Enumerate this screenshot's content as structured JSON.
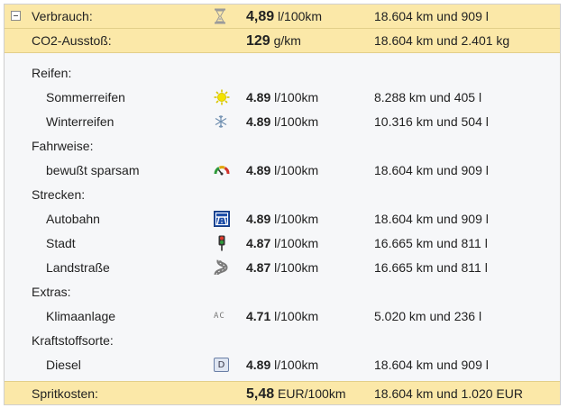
{
  "summary": {
    "consumption": {
      "label": "Verbrauch:",
      "value": "4,89",
      "unit": "l/100km",
      "distance": "18.604 km und 909 l"
    },
    "co2": {
      "label": "CO2-Ausstoß:",
      "value": "129",
      "unit": "g/km",
      "distance": "18.604 km und 2.401 kg"
    },
    "fuel_cost": {
      "label": "Spritkosten:",
      "value": "5,48",
      "unit": "EUR/100km",
      "distance": "18.604 km und 1.020 EUR"
    }
  },
  "categories": [
    {
      "label": "Reifen:",
      "items": [
        {
          "label": "Sommerreifen",
          "icon": "sun-icon",
          "value": "4.89",
          "unit": "l/100km",
          "distance": "8.288 km und 405 l"
        },
        {
          "label": "Winterreifen",
          "icon": "snowflake-icon",
          "value": "4.89",
          "unit": "l/100km",
          "distance": "10.316 km und 504 l"
        }
      ]
    },
    {
      "label": "Fahrweise:",
      "items": [
        {
          "label": "bewußt sparsam",
          "icon": "eco-gauge-icon",
          "value": "4.89",
          "unit": "l/100km",
          "distance": "18.604 km und 909 l"
        }
      ]
    },
    {
      "label": "Strecken:",
      "items": [
        {
          "label": "Autobahn",
          "icon": "highway-icon",
          "value": "4.89",
          "unit": "l/100km",
          "distance": "18.604 km und 909 l"
        },
        {
          "label": "Stadt",
          "icon": "traffic-light-icon",
          "value": "4.87",
          "unit": "l/100km",
          "distance": "16.665 km und 811 l"
        },
        {
          "label": "Landstraße",
          "icon": "winding-road-icon",
          "value": "4.87",
          "unit": "l/100km",
          "distance": "16.665 km und 811 l"
        }
      ]
    },
    {
      "label": "Extras:",
      "items": [
        {
          "label": "Klimaanlage",
          "icon": "ac-icon",
          "icon_text": "AC",
          "value": "4.71",
          "unit": "l/100km",
          "distance": "5.020 km und 236 l"
        }
      ]
    },
    {
      "label": "Kraftstoffsorte:",
      "items": [
        {
          "label": "Diesel",
          "icon": "diesel-icon",
          "icon_text": "D",
          "value": "4.89",
          "unit": "l/100km",
          "distance": "18.604 km und 909 l"
        }
      ]
    }
  ],
  "colors": {
    "highlight_row": "#fbe8a8",
    "panel_background": "#f6f7f9",
    "border": "#cfcfcf"
  }
}
